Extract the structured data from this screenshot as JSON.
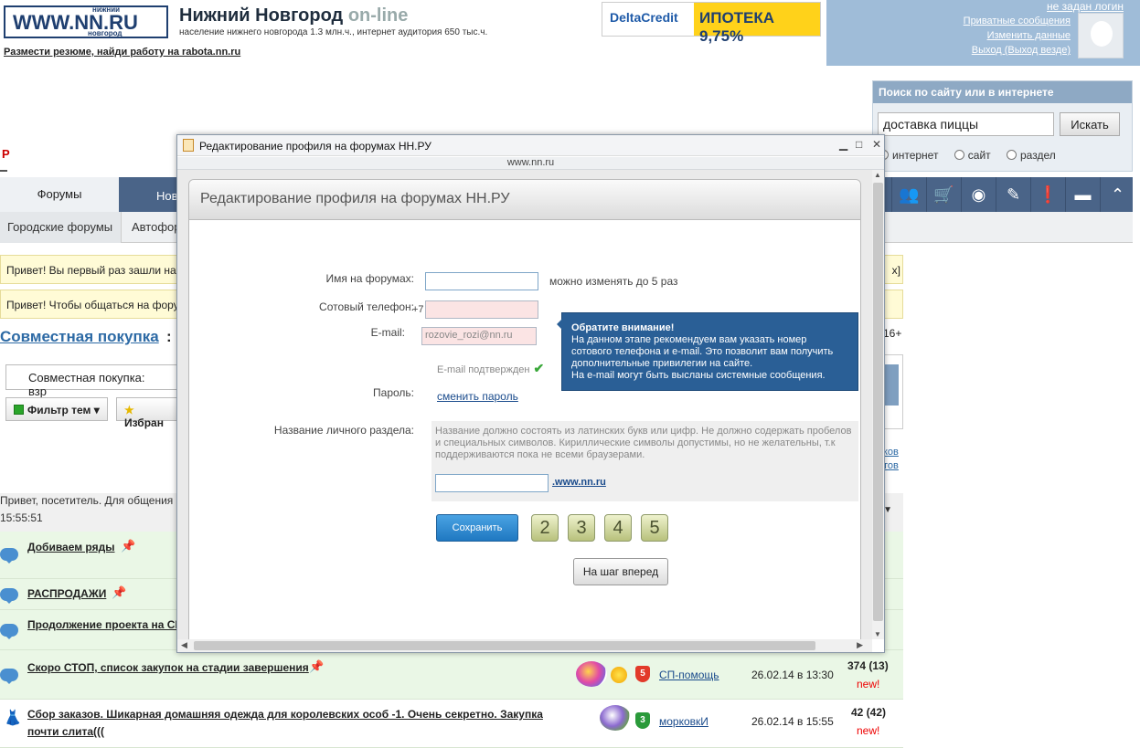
{
  "header": {
    "logo_main": "WWW.NN.RU",
    "logo_small_top": "нижний",
    "logo_small_bottom": "новгород",
    "site_title": "Нижний Новгород",
    "site_title_suffix": "on-line",
    "site_subtitle": "население нижнего новгорода 1.3 млн.ч., интернет аудитория 650 тыс.ч.",
    "resume_link": "Размести резюме, найди работу на rabota.nn.ru",
    "banner_brand": "DeltaCredit",
    "banner_text": "ИПОТЕКА 9,75%"
  },
  "userbox": {
    "login": "не задан логин",
    "private_messages": "Приватные сообщения",
    "change_data": "Изменить данные",
    "logout": "Выход (Выход везде)"
  },
  "search": {
    "heading": "Поиск по сайту или в интернете",
    "query": "доставка пиццы",
    "button": "Искать",
    "options": [
      "интернет",
      "сайт",
      "раздел"
    ]
  },
  "nav": {
    "active_tab": "Форумы",
    "second_tab": "Нов",
    "sub_tabs": [
      "Городские форумы",
      "Автофор"
    ],
    "icons": [
      "people-icon",
      "cart-icon",
      "eye-icon",
      "pencil-icon",
      "alert-icon",
      "chat-icon",
      "up-icon"
    ]
  },
  "notices": [
    "Привет! Вы первый раз зашли на",
    "Привет! Чтобы общаться на фору"
  ],
  "notice_close": "x]",
  "forum": {
    "heading": "Совместная покупка",
    "age": "16+",
    "select_value": "Совместная покупка: взр",
    "filter_button": "Фильтр тем",
    "fav_button": "Избран",
    "right_links": [
      "ков",
      "тов"
    ],
    "greeting": "Привет, посетитель. Для общения",
    "time": "15:55:51"
  },
  "topics": [
    {
      "title": "Добиваем ряды",
      "pinned": true
    },
    {
      "title": "РАСПРОДАЖИ",
      "pinned": true
    },
    {
      "title": "Продолжение проекта на СП",
      "pinned": false
    },
    {
      "title": "Скоро СТОП, список закупок на стадии завершения",
      "pinned": true,
      "author": "СП-помощь",
      "date": "26.02.14 в 13:30",
      "count": "374 (13)",
      "new": "new!",
      "badge": "5"
    },
    {
      "title": "Сбор заказов. Шикарная домашняя одежда для королевских особ -1. Очень секретно. Закупка почти слита(((",
      "pinned": false,
      "author": "морковкИ",
      "date": "26.02.14 в 15:55",
      "count": "42 (42)",
      "new": "new!",
      "badge": "3"
    }
  ],
  "dialog": {
    "window_title": "Редактирование профиля на форумах НН.РУ",
    "url": "www.nn.ru",
    "panel_title": "Редактирование профиля на форумах НН.РУ",
    "fields": {
      "nick_label": "Имя на форумах:",
      "nick_hint": "можно изменять до 5 раз",
      "phone_label": "Сотовый телефон:",
      "phone_prefix": "+7",
      "email_label": "E-mail:",
      "email_value": "rozovie_rozi@nn.ru",
      "email_confirmed": "E-mail подтвержден",
      "password_label": "Пароль:",
      "password_link": "сменить пароль",
      "section_label": "Название личного раздела:",
      "section_note": "Название должно состоять из латинских букв или цифр. Не должно содержать пробелов и специальных символов. Кириллические символы допустимы, но не желательны, т.к поддерживаются пока не всеми браузерами.",
      "section_suffix": ".www.nn.ru"
    },
    "tooltip": {
      "title": "Обратите внимание!",
      "text": "На данном этапе рекомендуем вам указать номер сотового телефона и e-mail. Это позволит вам получить дополнительные привилегии на сайте.",
      "text2": "На e-mail могут быть высланы системные сообщения."
    },
    "save_button": "Сохранить",
    "steps": [
      "2",
      "3",
      "4",
      "5"
    ],
    "next_button": "На шаг вперед"
  }
}
